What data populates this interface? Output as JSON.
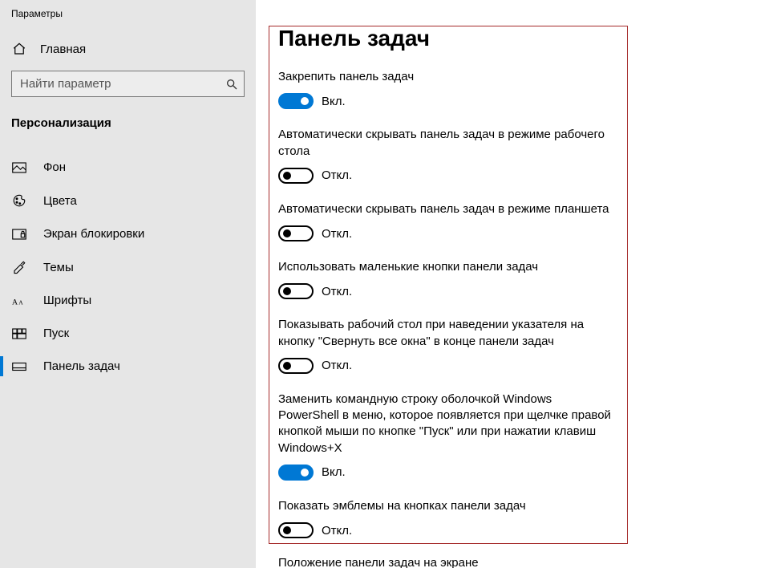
{
  "window_title": "Параметры",
  "home_label": "Главная",
  "search": {
    "placeholder": "Найти параметр"
  },
  "category_title": "Персонализация",
  "nav": [
    {
      "id": "background",
      "label": "Фон",
      "active": false
    },
    {
      "id": "colors",
      "label": "Цвета",
      "active": false
    },
    {
      "id": "lockscreen",
      "label": "Экран блокировки",
      "active": false
    },
    {
      "id": "themes",
      "label": "Темы",
      "active": false
    },
    {
      "id": "fonts",
      "label": "Шрифты",
      "active": false
    },
    {
      "id": "start",
      "label": "Пуск",
      "active": false
    },
    {
      "id": "taskbar",
      "label": "Панель задач",
      "active": true
    }
  ],
  "page_title": "Панель задач",
  "state_on": "Вкл.",
  "state_off": "Откл.",
  "settings": [
    {
      "id": "lock_taskbar",
      "label": "Закрепить панель задач",
      "on": true
    },
    {
      "id": "autohide_desktop",
      "label": "Автоматически скрывать панель задач в режиме рабочего стола",
      "on": false
    },
    {
      "id": "autohide_tablet",
      "label": "Автоматически скрывать панель задач в режиме планшета",
      "on": false
    },
    {
      "id": "small_buttons",
      "label": "Использовать маленькие кнопки панели задач",
      "on": false
    },
    {
      "id": "peek_desktop",
      "label": "Показывать рабочий стол при наведении указателя на кнопку \"Свернуть все окна\" в конце панели задач",
      "on": false
    },
    {
      "id": "powershell",
      "label": "Заменить командную строку оболочкой Windows PowerShell в меню, которое появляется при щелчке правой кнопкой мыши по кнопке \"Пуск\" или при нажатии клавиш Windows+X",
      "on": true
    },
    {
      "id": "badges",
      "label": "Показать эмблемы на кнопках панели задач",
      "on": false
    }
  ],
  "taskbar_position_label": "Положение панели задач на экране"
}
